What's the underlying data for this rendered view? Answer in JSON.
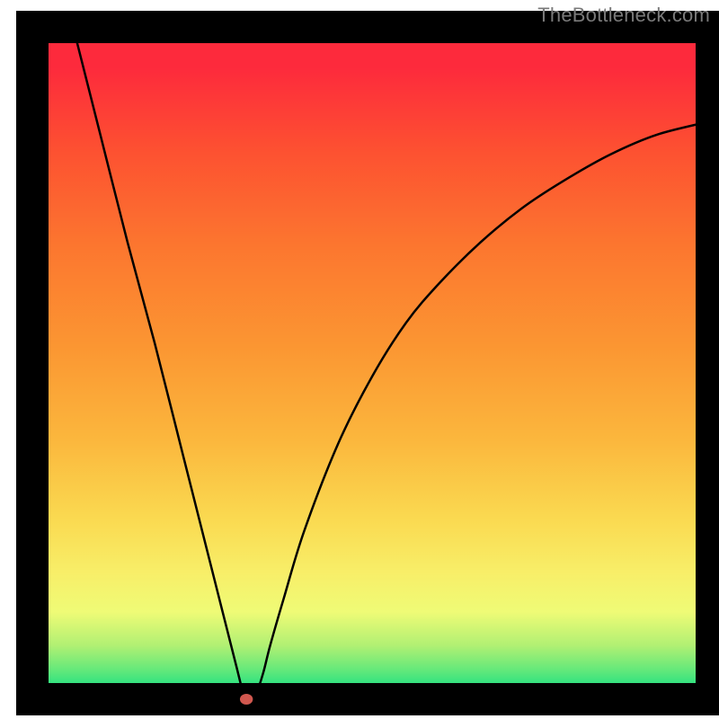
{
  "attribution": "TheBottleneck.com",
  "chart_data": {
    "type": "line",
    "title": "",
    "xlabel": "",
    "ylabel": "",
    "xlim": [
      0,
      100
    ],
    "ylim": [
      0,
      100
    ],
    "background_zones": [
      {
        "y0": 0,
        "y1": 3,
        "color": "#1fe082"
      },
      {
        "y0": 3,
        "y1": 6,
        "color": "#67e97a"
      },
      {
        "y0": 6,
        "y1": 10,
        "color": "#b1f073"
      },
      {
        "y0": 10,
        "y1": 16,
        "color": "#effb76"
      },
      {
        "y0": 16,
        "y1": 22,
        "color": "#f8ee68"
      },
      {
        "y0": 22,
        "y1": 32,
        "color": "#fad950"
      },
      {
        "y0": 32,
        "y1": 45,
        "color": "#fbb73d"
      },
      {
        "y0": 45,
        "y1": 60,
        "color": "#fb9632"
      },
      {
        "y0": 60,
        "y1": 75,
        "color": "#fc762f"
      },
      {
        "y0": 75,
        "y1": 88,
        "color": "#fd5131"
      },
      {
        "y0": 88,
        "y1": 100,
        "color": "#fd2a3c"
      }
    ],
    "optimum_marker": {
      "x": 31.5,
      "y": 0,
      "color": "#d1584f",
      "radius": 6
    },
    "series": [
      {
        "name": "bottleneck-curve",
        "color": "#000000",
        "width": 2.5,
        "x": [
          6,
          10,
          14,
          18,
          22,
          26,
          28,
          30,
          31,
          31.5,
          32,
          33,
          34,
          35,
          37,
          40,
          45,
          50,
          55,
          60,
          66,
          72,
          78,
          85,
          92,
          100
        ],
        "values": [
          100,
          84,
          68,
          53,
          37,
          21,
          13,
          5,
          1,
          0,
          0,
          1,
          4,
          8,
          15,
          25,
          38,
          48,
          56,
          62,
          68,
          73,
          77,
          81,
          84,
          86
        ]
      }
    ]
  }
}
